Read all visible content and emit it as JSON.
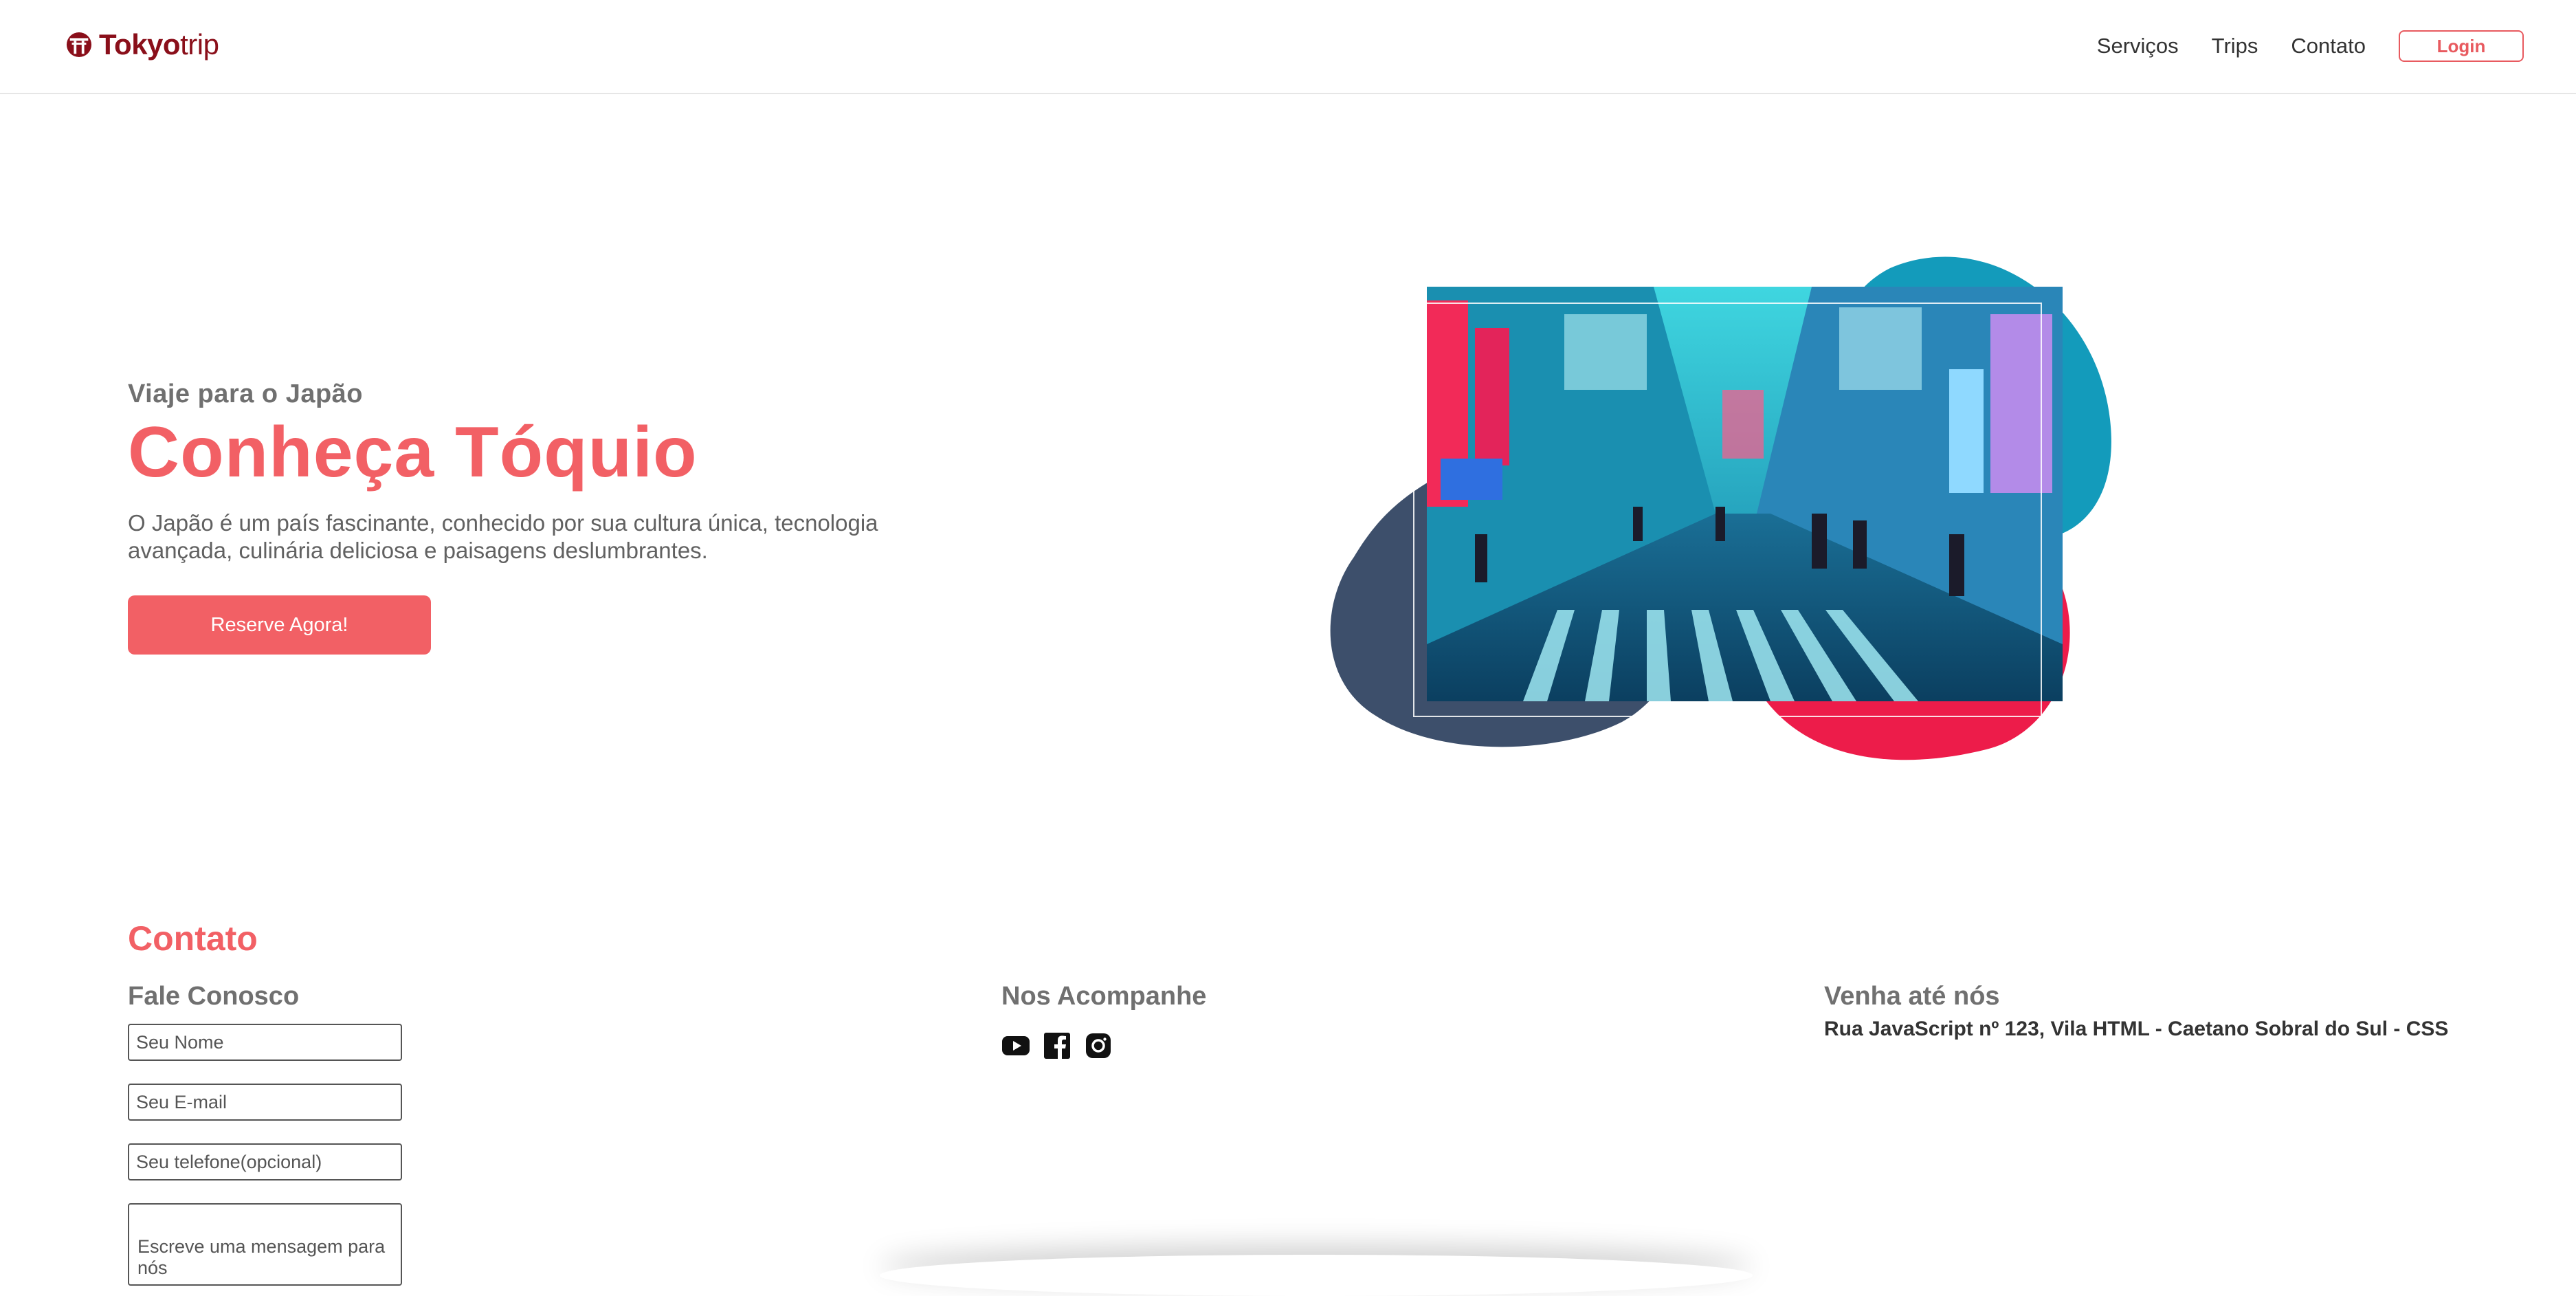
{
  "brand": {
    "name_bold": "Tokyo",
    "name_light": "trip",
    "color": "#8a0f1a",
    "icon": "torii-gate-icon"
  },
  "nav": {
    "items": [
      {
        "label": "Serviços"
      },
      {
        "label": "Trips"
      },
      {
        "label": "Contato"
      }
    ],
    "login_label": "Login"
  },
  "hero": {
    "eyebrow": "Viaje para o Japão",
    "title": "Conheça Tóquio",
    "description": "O Japão é um país fascinante, conhecido por sua cultura única, tecnologia avançada, culinária deliciosa e paisagens deslumbrantes.",
    "cta_label": "Reserve Agora!",
    "accent_color": "#f26065",
    "image": "tokyo-street-neon-photo"
  },
  "contact": {
    "title": "Contato",
    "form": {
      "title": "Fale Conosco",
      "name_placeholder": "Seu Nome",
      "email_placeholder": "Seu E-mail",
      "phone_placeholder": "Seu telefone(opcional)",
      "message_placeholder": "Escreve uma mensagem para nós"
    },
    "social": {
      "title": "Nos Acompanhe",
      "icons": [
        "youtube-icon",
        "facebook-icon",
        "instagram-icon"
      ]
    },
    "location": {
      "title": "Venha até nós",
      "address": "Rua JavaScript nº 123, Vila HTML - Caetano Sobral do Sul - CSS"
    }
  }
}
